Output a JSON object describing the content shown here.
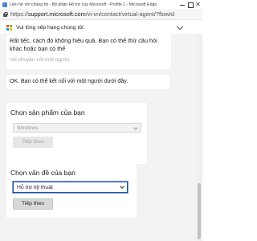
{
  "window": {
    "title": "Liên hệ với chúng tôi - Bộ phận Hỗ trợ của Microsoft - Profile 1 - Microsoft Edge",
    "close_glyph": "✕"
  },
  "address_bar": {
    "url_prefix": "https://",
    "url_host": "support.microsoft.com",
    "url_path": "/vi-vn/contact/virtual-agent/?flowId"
  },
  "chat_header": {
    "rate_text": "Vui lòng xếp hạng chúng tôi:",
    "logo_colors": [
      "#f25022",
      "#7fba00",
      "#00a4ef",
      "#ffb900"
    ]
  },
  "messages": {
    "sorry": "Rất tiếc, cách đó không hiệu quả. Bạn có thể thử câu hỏi khác hoặc bạn có thể",
    "talk_link": "nói chuyện với một người",
    "ok": "OK. Bạn có thể kết nối với một người dưới đây."
  },
  "product_card": {
    "title": "Chọn sản phẩm của bạn",
    "selected": "Windows",
    "next_label": "Tiếp theo"
  },
  "issue_card": {
    "title": "Chọn vấn đề của bạn",
    "selected": "Hỗ trợ kỹ thuật",
    "next_label": "Tiếp theo"
  },
  "colors": {
    "focus_border": "#1f4ea3",
    "content_bg": "#f3f3f3",
    "disabled_text": "#a8a8a8"
  }
}
